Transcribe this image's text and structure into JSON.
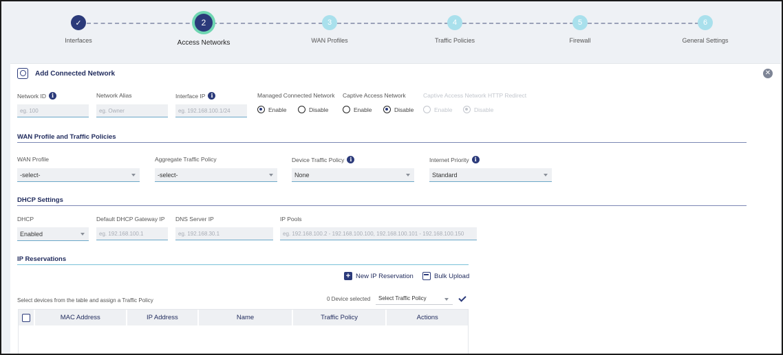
{
  "stepper": {
    "steps": [
      {
        "number": "✓",
        "label": "Interfaces",
        "state": "done"
      },
      {
        "number": "2",
        "label": "Access Networks",
        "state": "active"
      },
      {
        "number": "3",
        "label": "WAN Profiles",
        "state": "pending"
      },
      {
        "number": "4",
        "label": "Traffic Policies",
        "state": "pending"
      },
      {
        "number": "5",
        "label": "Firewall",
        "state": "pending"
      },
      {
        "number": "6",
        "label": "General Settings",
        "state": "pending"
      }
    ]
  },
  "card": {
    "title": "Add Connected Network",
    "icon": "network-icon",
    "close_icon": "close-icon"
  },
  "basic": {
    "network_id_label": "Network ID",
    "network_id_placeholder": "eg. 100",
    "network_alias_label": "Network Alias",
    "network_alias_placeholder": "eg. Owner",
    "interface_ip_label": "Interface IP",
    "interface_ip_placeholder": "eg. 192.168.100.1/24",
    "managed_label": "Managed Connected Network",
    "managed_enable": "Enable",
    "managed_disable": "Disable",
    "captive_label": "Captive Access Network",
    "captive_enable": "Enable",
    "captive_disable": "Disable",
    "redirect_label": "Captive Access Network HTTP Redirect",
    "redirect_enable": "Enable",
    "redirect_disable": "Disable"
  },
  "wan_section": {
    "title": "WAN Profile and Traffic Policies",
    "wan_profile_label": "WAN Profile",
    "wan_profile_value": "-select-",
    "aggregate_label": "Aggregate Traffic Policy",
    "aggregate_value": "-select-",
    "device_label": "Device Traffic Policy",
    "device_value": "None",
    "priority_label": "Internet Priority",
    "priority_value": "Standard"
  },
  "dhcp_section": {
    "title": "DHCP Settings",
    "dhcp_label": "DHCP",
    "dhcp_value": "Enabled",
    "gateway_label": "Default DHCP Gateway IP",
    "gateway_placeholder": "eg. 192.168.100.1",
    "dns_label": "DNS Server IP",
    "dns_placeholder": "eg. 192.168.30.1",
    "pools_label": "IP Pools",
    "pools_placeholder": "eg. 192.168.100.2 - 192.168.100.100, 192.168.100.101 - 192.168.100.150"
  },
  "reservations": {
    "title": "IP Reservations",
    "new_button": "New IP Reservation",
    "bulk_button": "Bulk Upload",
    "instruction": "Select devices from the table and assign a Traffic Policy",
    "selected_count": "0 Device selected",
    "policy_select": "Select Traffic Policy",
    "columns": [
      "MAC Address",
      "IP Address",
      "Name",
      "Traffic Policy",
      "Actions"
    ]
  },
  "colors": {
    "primary": "#2b3a7a",
    "active_ring": "#6fd6b2",
    "pending": "#a9e0ec",
    "underline": "#6aa7c8"
  }
}
